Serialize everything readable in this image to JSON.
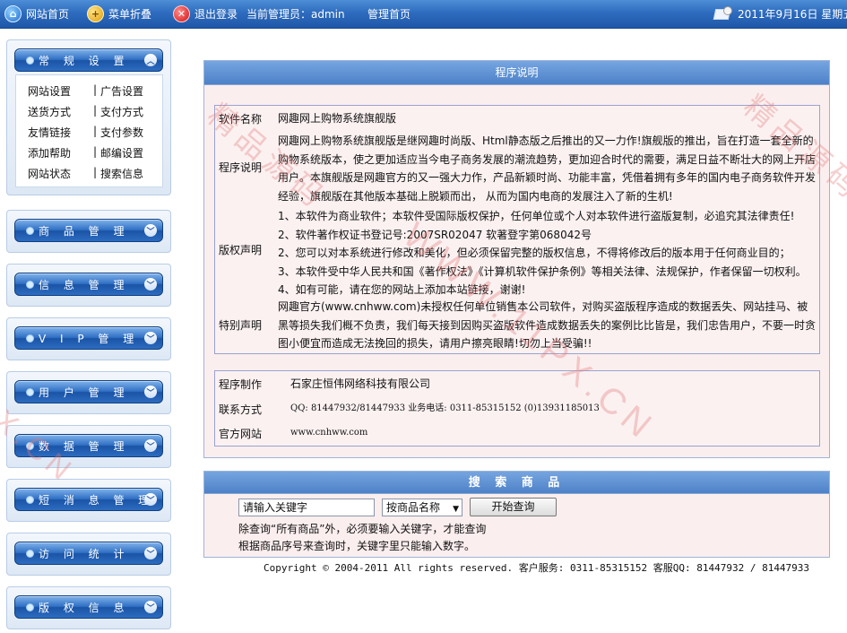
{
  "topbar": {
    "home": "网站首页",
    "fold": "菜单折叠",
    "logout": "退出登录",
    "admin": "当前管理员：admin",
    "manage_home": "管理首页",
    "date": "2011年9月16日 星期五"
  },
  "sidebar": {
    "menus": [
      {
        "title": "常 规 设 置",
        "open": true,
        "items": [
          [
            "网站设置",
            "广告设置"
          ],
          [
            "送货方式",
            "支付方式"
          ],
          [
            "友情链接",
            "支付参数"
          ],
          [
            "添加帮助",
            "邮编设置"
          ],
          [
            "网站状态",
            "搜索信息"
          ]
        ]
      },
      {
        "title": "商 品 管 理"
      },
      {
        "title": "信 息 管 理"
      },
      {
        "title": "V I P 管 理"
      },
      {
        "title": "用 户 管 理"
      },
      {
        "title": "数 据 管 理"
      },
      {
        "title": "短 消 息 管 理"
      },
      {
        "title": "访 问 统 计"
      },
      {
        "title": "版 权 信 息"
      }
    ],
    "separator": "|"
  },
  "program": {
    "title": "程序说明",
    "software_name_label": "软件名称",
    "software_name": "网趣网上购物系统旗舰版",
    "desc_label": "程序说明",
    "desc": "网趣网上购物系统旗舰版是继网趣时尚版、Html静态版之后推出的又一力作!旗舰版的推出，旨在打造一套全新的购物系统版本，使之更加适应当今电子商务发展的潮流趋势，更加迎合时代的需要，满足日益不断壮大的网上开店用户。本旗舰版是网趣官方的又一强大力作，产品新颖时尚、功能丰富，凭借着拥有多年的国内电子商务软件开发经验，旗舰版在其他版本基础上脱颖而出， 从而为国内电商的发展注入了新的生机!",
    "copyright_label": "版权声明",
    "copyright": [
      "1、本软件为商业软件；本软件受国际版权保护，任何单位或个人对本软件进行盗版复制，必追究其法律责任!",
      "2、软件著作权证书登记号:2007SR02047 软著登字第068042号",
      "2、您可以对本系统进行修改和美化，但必须保留完整的版权信息，不得将修改后的版本用于任何商业目的；",
      "3、本软件受中华人民共和国《著作权法》《计算机软件保护条例》等相关法律、法规保护，作者保留一切权利。",
      "4、如有可能，请在您的网站上添加本站链接，谢谢!"
    ],
    "special_label": "特别声明",
    "special": "网趣官方(www.cnhww.com)未授权任何单位销售本公司软件，对购买盗版程序造成的数据丢失、网站挂马、被黑等损失我们概不负责，我们每天接到因购买盗版软件造成数据丢失的案例比比皆是，我们忠告用户，不要一时贪图小便宜而造成无法挽回的损失，请用户擦亮眼睛!切勿上当受骗!!",
    "maker_label": "程序制作",
    "maker": "石家庄恒伟网络科技有限公司",
    "contact_label": "联系方式",
    "contact": "QQ: 81447932/81447933 业务电话: 0311-85315152 (0)13931185013",
    "site_label": "官方网站",
    "site": "www.cnhww.com"
  },
  "watermark": {
    "left": "精品源码",
    "center": "WWW.11PX.CN",
    "right": "精品源码",
    "edge": "PX.CN"
  },
  "search": {
    "title": "搜 索 商 品",
    "input_value": "请输入关键字",
    "select_value": "按商品名称",
    "button": "开始查询",
    "note1": "除查询“所有商品”外，必须要输入关键字，才能查询",
    "note2": "根据商品序号来查询时，关键字里只能输入数字。"
  },
  "footer": "Copyright © 2004-2011 All rights reserved. 客户服务: 0311-85315152 客服QQ: 81447932 / 81447933"
}
